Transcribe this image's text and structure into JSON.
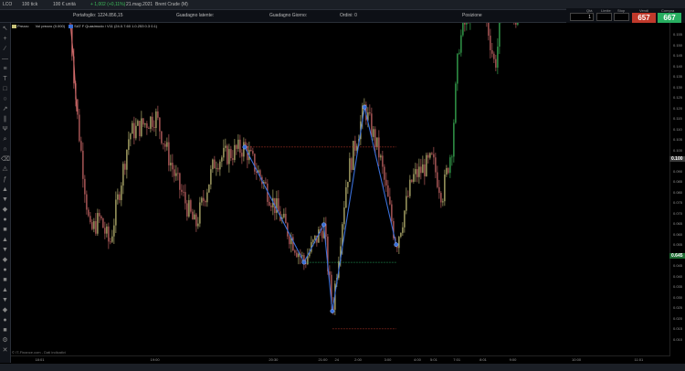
{
  "topbar": {
    "symbol": "LCO",
    "period": "100 tick",
    "unit": "100 € unità",
    "price_change": "+ 1,002 (+0,11%)",
    "date": "21.mag.2021",
    "instrument": "Brent Crude (M)"
  },
  "infobar": {
    "portfolio_label": "Portafoglio",
    "portfolio_value": "1224.856,15",
    "latent_label": "Guadagno latente:",
    "day_gain_label": "Guadagno Giorno:",
    "orders_label": "Ordini",
    "orders_value": "0",
    "position_label": "Posizione"
  },
  "order_panel": {
    "qty_label": "Qtà",
    "qty_value": "1",
    "limit_label": "Limite",
    "stop_label": "Stop",
    "sell_label": "Vendi",
    "sell_value": "657",
    "buy_label": "Compra",
    "buy_value": "667"
  },
  "legend": {
    "price_label": "Prezzo",
    "volume_label": "Vol prezzo (0.000)",
    "indicator_label": "SAT F Quasimodo / V11 (24.0.7.60 1.0.253 0.3 0.1)"
  },
  "y_axis": [
    "0.155",
    "0.150",
    "0.145",
    "0.140",
    "0.135",
    "0.130",
    "0.125",
    "0.120",
    "0.115",
    "0.110",
    "0.105",
    "0.100",
    "0.095",
    "0.090",
    "0.085",
    "0.080",
    "0.075",
    "0.070",
    "0.065",
    "0.060",
    "0.055",
    "0.050",
    "0.045",
    "0.040",
    "0.035",
    "0.030",
    "0.025",
    "0.020",
    "0.015",
    "0.010"
  ],
  "price_markers": {
    "current": "0.100",
    "lower": "0.645"
  },
  "x_axis": [
    {
      "label": "18:01",
      "pos": 0.045
    },
    {
      "label": "19:00",
      "pos": 0.22
    },
    {
      "label": "20:30",
      "pos": 0.4
    },
    {
      "label": "21:00",
      "pos": 0.475
    },
    {
      "label": "24",
      "pos": 0.5
    },
    {
      "label": "2:00",
      "pos": 0.53
    },
    {
      "label": "3:00",
      "pos": 0.575
    },
    {
      "label": "4:00",
      "pos": 0.62
    },
    {
      "label": "5:01",
      "pos": 0.645
    },
    {
      "label": "7:01",
      "pos": 0.68
    },
    {
      "label": "8:01",
      "pos": 0.72
    },
    {
      "label": "9:00",
      "pos": 0.765
    },
    {
      "label": "10:00",
      "pos": 0.86
    },
    {
      "label": "11:01",
      "pos": 0.955
    }
  ],
  "footer_note": "© IT-Finance.com - Dati indicativi",
  "chart_data": {
    "type": "candlestick",
    "description_of_path": "intraday candles with a Quasimodo zigzag pattern overlay",
    "ylim": [
      0.01,
      0.16
    ],
    "zigzag_points": [
      {
        "x": 0.355,
        "y": 0.104
      },
      {
        "x": 0.445,
        "y": 0.052
      },
      {
        "x": 0.475,
        "y": 0.069
      },
      {
        "x": 0.488,
        "y": 0.03
      },
      {
        "x": 0.537,
        "y": 0.122
      },
      {
        "x": 0.585,
        "y": 0.06
      }
    ],
    "levels": [
      {
        "y": 0.104,
        "color": "#c0392b"
      },
      {
        "y": 0.052,
        "color": "#27ae60"
      },
      {
        "y": 0.022,
        "color": "#c0392b"
      }
    ],
    "colors": {
      "up": "#c8c27a",
      "down": "#d06a6a",
      "zigzag": "#3a6fd8",
      "up_strong": "#3dbb5a"
    }
  }
}
